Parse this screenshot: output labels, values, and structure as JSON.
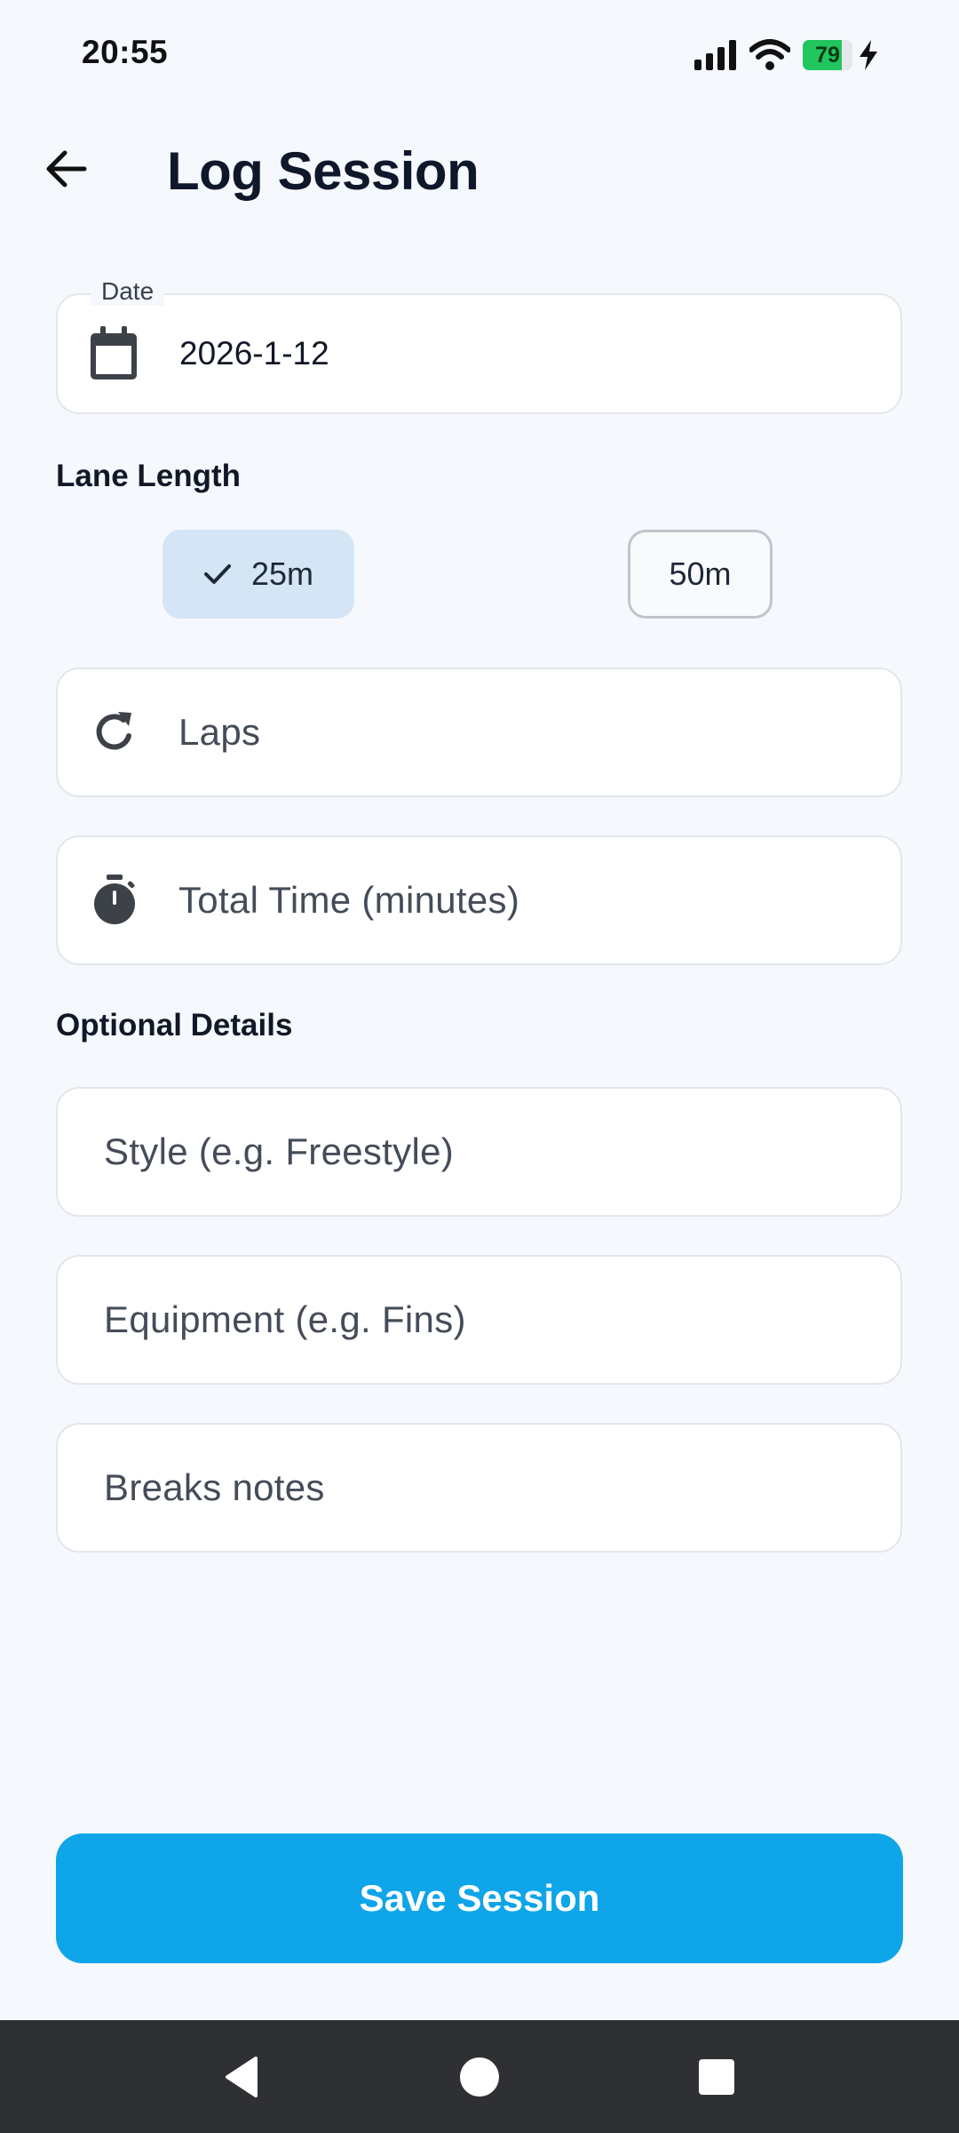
{
  "status_bar": {
    "time": "20:55",
    "battery_level": "79",
    "battery_fraction": 0.79,
    "icons": [
      "signal-icon",
      "wifi-icon",
      "battery-icon",
      "charging-bolt-icon"
    ]
  },
  "header": {
    "title": "Log Session",
    "back_icon": "arrow-left-icon"
  },
  "form": {
    "date": {
      "label": "Date",
      "value": "2026-1-12",
      "icon": "calendar-icon"
    },
    "lane_length": {
      "label": "Lane Length",
      "options": [
        {
          "label": "25m",
          "selected": true
        },
        {
          "label": "50m",
          "selected": false
        }
      ]
    },
    "laps": {
      "placeholder": "Laps",
      "value": "",
      "icon": "refresh-icon"
    },
    "total_time": {
      "placeholder": "Total Time (minutes)",
      "value": "",
      "icon": "stopwatch-icon"
    },
    "optional_details": {
      "label": "Optional Details",
      "style": {
        "placeholder": "Style (e.g. Freestyle)",
        "value": ""
      },
      "equipment": {
        "placeholder": "Equipment (e.g. Fins)",
        "value": ""
      },
      "breaks": {
        "placeholder": "Breaks notes",
        "value": ""
      }
    }
  },
  "save_button": {
    "label": "Save Session"
  },
  "nav_bar": {
    "icons": [
      "nav-back-icon",
      "nav-home-icon",
      "nav-recents-icon"
    ]
  },
  "colors": {
    "background": "#f5f8fc",
    "accent": "#0ea5e9",
    "chip_selected": "#d4e5f5",
    "battery_green": "#22c55e",
    "nav_bar": "#2f3033"
  }
}
